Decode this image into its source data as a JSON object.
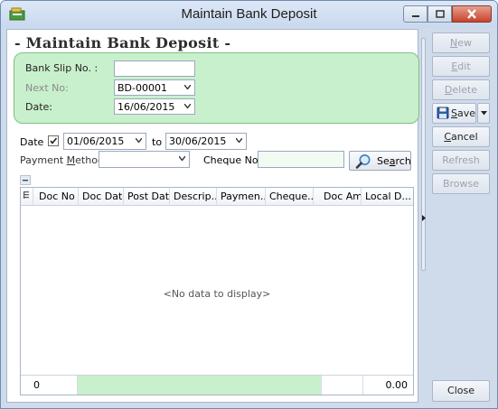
{
  "window": {
    "title": "Maintain Bank Deposit"
  },
  "form": {
    "heading": "- Maintain Bank Deposit -",
    "bank_slip_label": "Bank Slip No. :",
    "bank_slip_value": "",
    "next_no_label": "Next No:",
    "next_no_value": "BD-00001",
    "date_label": "Date:",
    "date_value": "16/06/2015"
  },
  "filter": {
    "date_label": "Date",
    "date_checked": true,
    "date_from": "01/06/2015",
    "to_label": "to",
    "date_to": "30/06/2015",
    "payment_method_label_pre": "Payment ",
    "payment_method_label_u": "M",
    "payment_method_label_post": "ethod:",
    "payment_method_value": "",
    "cheque_label": "Cheque No. :",
    "cheque_value": "",
    "search_pre": "Se",
    "search_u": "a",
    "search_post": "rch"
  },
  "grid": {
    "columns": [
      "Doc No",
      "Doc Date",
      "Post Date",
      "Descrip...",
      "Paymen...",
      "Cheque...",
      "Doc Amt",
      "Local D..."
    ],
    "empty_text": "<No data to display>",
    "footer_count": "0",
    "footer_total": "0.00"
  },
  "actions": {
    "new": {
      "pre": "",
      "u": "N",
      "post": "ew"
    },
    "edit": {
      "pre": "",
      "u": "E",
      "post": "dit"
    },
    "delete": {
      "pre": "",
      "u": "D",
      "post": "elete"
    },
    "save": {
      "pre": "",
      "u": "S",
      "post": "ave"
    },
    "cancel": {
      "pre": "",
      "u": "C",
      "post": "ancel"
    },
    "refresh": "Refresh",
    "browse": "Browse",
    "close": "Close"
  },
  "colors": {
    "green_box": "#c9f0cc",
    "footer_green": "#c9f0cc",
    "window_bg": "#cfdbeb"
  },
  "icons": [
    "app-icon",
    "minimize-icon",
    "maximize-icon",
    "close-icon",
    "combo-arrow-icon",
    "checkmark-icon",
    "search-magnifier-icon",
    "collapse-icon",
    "column-chooser-icon",
    "floppy-save-icon",
    "expand-arrow-icon"
  ]
}
